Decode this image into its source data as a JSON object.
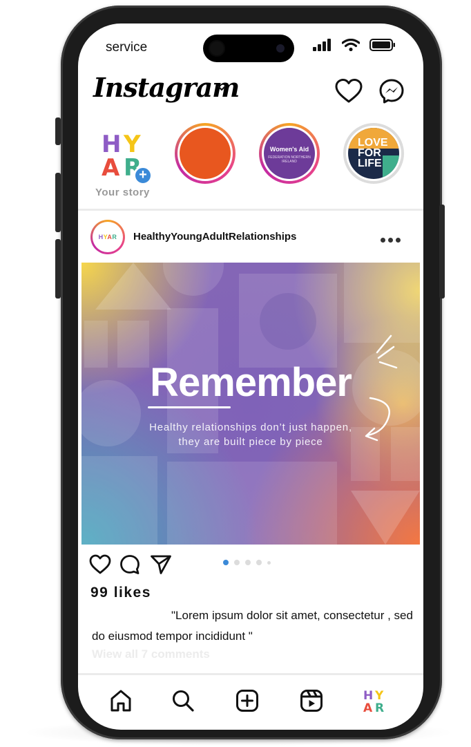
{
  "status_bar": {
    "carrier": "service"
  },
  "header": {
    "logo": "Instagram",
    "icons": [
      "chevron-down-icon",
      "heart-icon",
      "messenger-icon"
    ]
  },
  "stories": [
    {
      "label": "Your story",
      "avatar_text": "HY AR",
      "has_add": true
    },
    {
      "label": "",
      "fill": "#e8571f"
    },
    {
      "label": "",
      "fill": "#6d3b99",
      "text": "Women's Aid",
      "subtext": "FEDERATION NORTHERN IRELAND"
    },
    {
      "label": "",
      "fill": "#1b2a48",
      "text": "LOVE FOR LIFE"
    }
  ],
  "post": {
    "username": "HealthyYoungAdultRelationships",
    "avatar_text": "HYAR",
    "image": {
      "title": "Remember",
      "subtitle_line1": "Healthy relationships don’t just happen,",
      "subtitle_line2": "they are built piece by piece"
    },
    "carousel": {
      "total": 5,
      "active_index": 0
    },
    "likes": "99 likes",
    "caption": "\"Lorem ipsum dolor sit amet, consectetur , sed do eiusmod tempor incididunt \"",
    "view_comments": "Wiew all 7 comments"
  },
  "bottom_nav": [
    "home-icon",
    "search-icon",
    "create-icon",
    "reels-icon",
    "profile-avatar"
  ],
  "colors": {
    "accent_blue": "#3b8ad8",
    "story_gradient": [
      "#f6a623",
      "#e8438a",
      "#c32aa3"
    ],
    "logo_h": "#8e5cc5",
    "logo_y": "#f5c518",
    "logo_a": "#e84d3d",
    "logo_r": "#3fae8c"
  }
}
